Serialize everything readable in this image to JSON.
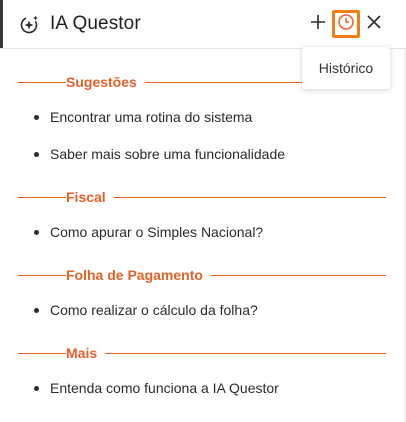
{
  "header": {
    "title": "IA Questor",
    "icons": [
      "sparkle-icon",
      "plus-icon",
      "clock-icon",
      "close-icon"
    ]
  },
  "tooltip": {
    "text": "Histórico"
  },
  "sections": [
    {
      "label": "Sugestões",
      "items": [
        "Encontrar uma rotina do sistema",
        "Saber mais sobre uma funcionalidade"
      ]
    },
    {
      "label": "Fiscal",
      "items": [
        "Como apurar o Simples Nacional?"
      ]
    },
    {
      "label": "Folha de Pagamento",
      "items": [
        "Como realizar o cálculo da folha?"
      ]
    },
    {
      "label": "Mais",
      "items": [
        "Entenda como funciona a IA Questor"
      ]
    }
  ],
  "colors": {
    "accent": "#e2622a",
    "highlight": "#ef7d1a",
    "text": "#2b2b2b"
  }
}
